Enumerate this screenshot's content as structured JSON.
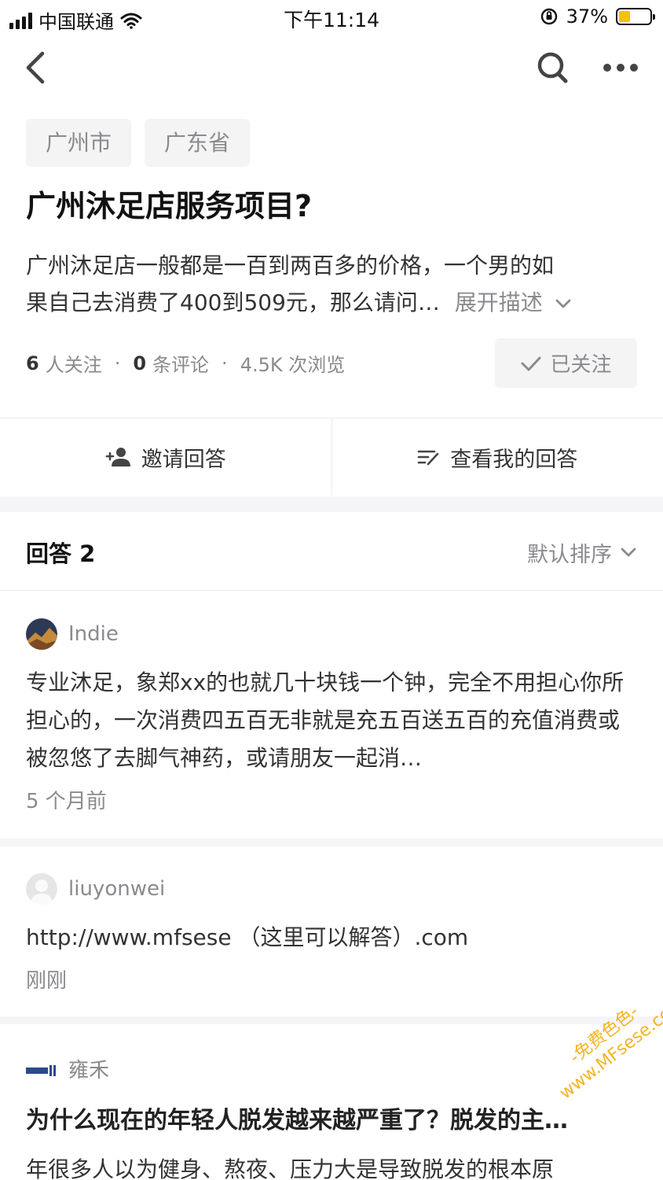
{
  "status_bar": {
    "carrier": "中国联通",
    "time": "下午11:14",
    "battery": "37%",
    "battery_level": 0.37,
    "colors": {
      "battery_fill": "#f5c400"
    }
  },
  "nav": {
    "icons": [
      "chevron-left-icon",
      "search-icon",
      "more-icon"
    ]
  },
  "question": {
    "tags": [
      "广州市",
      "广东省"
    ],
    "title": "广州沐足店服务项目?",
    "description_line1": "广州沐足店一般都是一百到两百多的价格，一个男的如",
    "description_line2": "果自己去消费了400到509元，那么请问…",
    "expand_label": "展开描述",
    "followers_count": "6",
    "followers_label": "人关注",
    "comments_count": "0",
    "comments_label": "条评论",
    "views": "4.5K 次浏览",
    "follow_button": "已关注"
  },
  "actions": {
    "invite": "邀请回答",
    "my_answer": "查看我的回答"
  },
  "answers": {
    "header": "回答 2",
    "sort_label": "默认排序",
    "items": [
      {
        "author": "Indie",
        "text": "专业沐足，象郑xx的也就几十块钱一个钟，完全不用担心你所担心的，一次消费四五百无非就是充五百送五百的充值消费或被忽悠了去脚气神药，或请朋友一起消…",
        "time": "5 个月前"
      },
      {
        "author": "liuyonwei",
        "text": "http://www.mfsese （这里可以解答）.com",
        "time": "刚刚"
      }
    ]
  },
  "recommended": {
    "author": "雍禾",
    "title": "为什么现在的年轻人脱发越来越严重了？脱发的主…",
    "text": "年很多人以为健身、熬夜、压力大是导致脱发的根本原"
  },
  "watermark": "-免费色色-\nwww.MFsese.com"
}
